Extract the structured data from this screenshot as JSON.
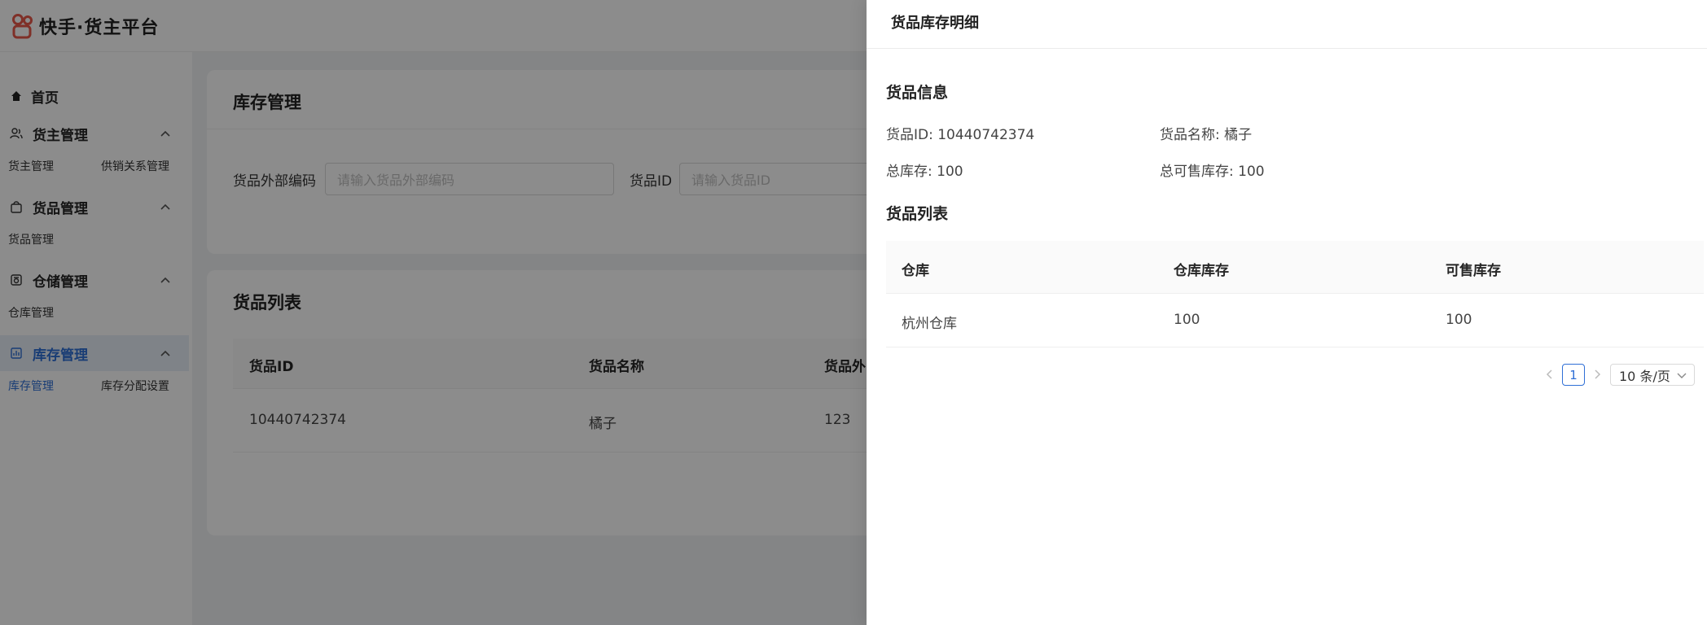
{
  "header": {
    "app_title": "快手·货主平台"
  },
  "sidebar": {
    "home": "首页",
    "groups": [
      {
        "label": "货主管理",
        "items": [
          "货主管理",
          "供销关系管理"
        ]
      },
      {
        "label": "货品管理",
        "items": [
          "货品管理"
        ]
      },
      {
        "label": "仓储管理",
        "items": [
          "仓库管理"
        ]
      },
      {
        "label": "库存管理",
        "items": [
          "库存管理",
          "库存分配设置"
        ]
      }
    ]
  },
  "main": {
    "filter_card": {
      "title": "库存管理",
      "fields": [
        {
          "label": "货品外部编码",
          "placeholder": "请输入货品外部编码"
        },
        {
          "label": "货品ID",
          "placeholder": "请输入货品ID"
        }
      ]
    },
    "list_card": {
      "title": "货品列表",
      "columns": [
        "货品ID",
        "货品名称",
        "货品外"
      ],
      "rows": [
        [
          "10440742374",
          "橘子",
          "123"
        ]
      ]
    }
  },
  "drawer": {
    "title": "货品库存明细",
    "info_section": "货品信息",
    "info": {
      "id": "货品ID: 10440742374",
      "name": "货品名称: 橘子",
      "total_stock": "总库存: 100",
      "total_sellable": "总可售库存: 100"
    },
    "list_section": "货品列表",
    "table": {
      "columns": [
        "仓库",
        "仓库库存",
        "可售库存"
      ],
      "rows": [
        [
          "杭州仓库",
          "100",
          "100"
        ]
      ]
    },
    "pagination": {
      "current_page": "1",
      "page_size": "10 条/页"
    }
  },
  "colors": {
    "accent": "#2f6fd6",
    "logo": "#e8584a",
    "overlay": "rgba(0,0,0,0.45)"
  }
}
